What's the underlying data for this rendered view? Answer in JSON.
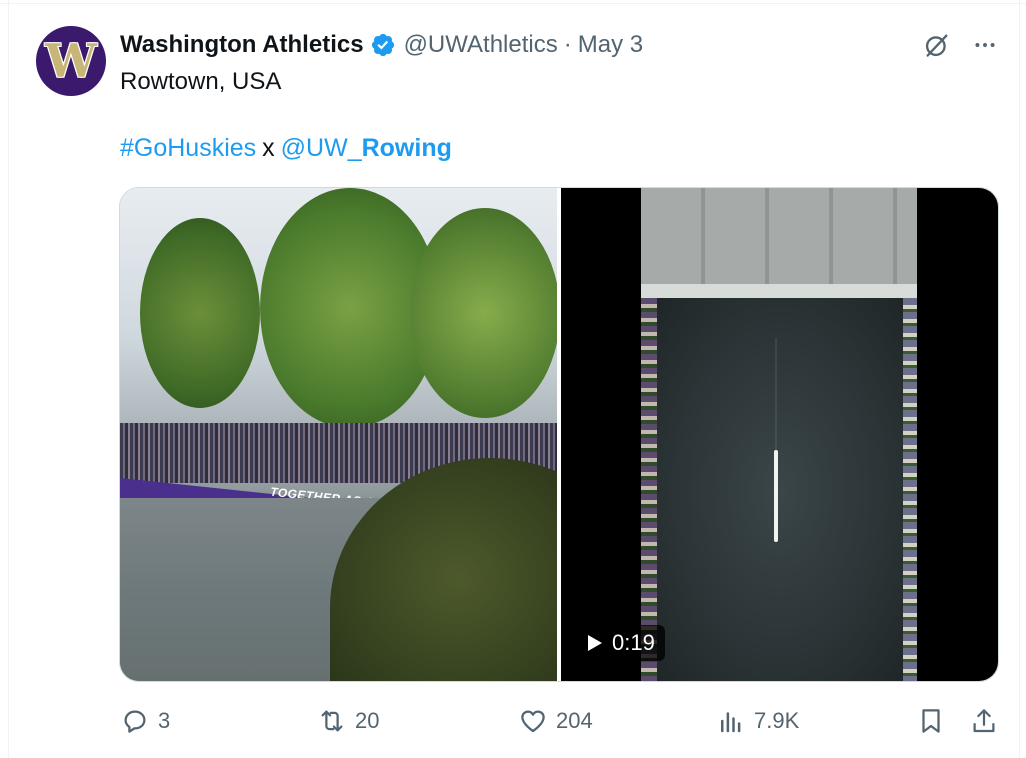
{
  "account": {
    "display_name": "Washington Athletics",
    "handle": "@UWAthletics",
    "separator": "·",
    "date": "May 3",
    "avatar_letter": "W",
    "location": "Rowtown, USA"
  },
  "tweet": {
    "hashtag": "#GoHuskies",
    "connector": "x",
    "mention_prefix": "@UW_",
    "mention_bold": "Rowing"
  },
  "media": {
    "video_duration": "0:19",
    "banner_text": "TOGETHER AS ONE"
  },
  "actions": {
    "replies": "3",
    "reposts": "20",
    "likes": "204",
    "views": "7.9K"
  },
  "icons": {
    "verified": "verified-badge-icon",
    "grok": "grok-icon",
    "more": "more-icon",
    "reply": "reply-icon",
    "repost": "repost-icon",
    "like": "heart-icon",
    "views": "views-icon",
    "bookmark": "bookmark-icon",
    "share": "share-icon",
    "play": "play-icon"
  },
  "colors": {
    "accent": "#1d9bf0",
    "secondary_text": "#536471",
    "avatar_bg": "#3b1a6e"
  }
}
